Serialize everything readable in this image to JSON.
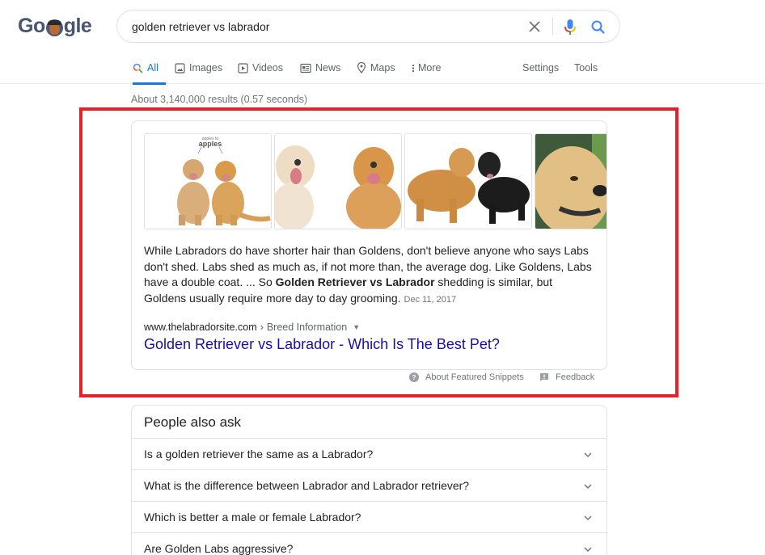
{
  "logo": {
    "text_before": "Go",
    "text_after": "gle",
    "doodle": "doodle-portrait-icon"
  },
  "search": {
    "query": "golden retriever vs labrador",
    "clear_icon": "close-icon",
    "mic_icon": "microphone-icon",
    "search_icon": "search-icon"
  },
  "tabs": [
    {
      "label": "All",
      "icon": "search-icon",
      "active": true
    },
    {
      "label": "Images",
      "icon": "image-icon",
      "active": false
    },
    {
      "label": "Videos",
      "icon": "play-icon",
      "active": false
    },
    {
      "label": "News",
      "icon": "newspaper-icon",
      "active": false
    },
    {
      "label": "Maps",
      "icon": "map-pin-icon",
      "active": false
    },
    {
      "label": "More",
      "icon": "more-vert-icon",
      "active": false
    }
  ],
  "tools": {
    "settings": "Settings",
    "tools": "Tools"
  },
  "result_stats": "About 3,140,000 results (0.57 seconds)",
  "featured_snippet": {
    "images": [
      {
        "alt": "Labrador and golden retriever sitting side by side",
        "caption_small": "apples to",
        "caption_big": "apples"
      },
      {
        "alt": "Yellow Labrador and golden retriever lying down"
      },
      {
        "alt": "Golden retriever standing beside black Labrador"
      },
      {
        "alt": "Golden retriever head close-up"
      }
    ],
    "text_part1": "While Labradors do have shorter hair than Goldens, don't believe anyone who says Labs don't shed. Labs shed as much as, if not more than, the average dog. Like Goldens, Labs have a double coat. ... So ",
    "text_bold": "Golden Retriever vs Labrador",
    "text_part2": " shedding is similar, but Goldens usually require more day to day grooming.",
    "date": "Dec 11, 2017",
    "cite_domain": "www.thelabradorsite.com",
    "cite_separator": "›",
    "cite_path": "Breed Information",
    "cite_menu_icon": "▼",
    "title_link": "Golden Retriever vs Labrador - Which Is The Best Pet?"
  },
  "snippet_footer": {
    "about": "About Featured Snippets",
    "feedback": "Feedback"
  },
  "people_also_ask": {
    "title": "People also ask",
    "questions": [
      "Is a golden retriever the same as a Labrador?",
      "What is the difference between Labrador and Labrador retriever?",
      "Which is better a male or female Labrador?",
      "Are Golden Labs aggressive?"
    ]
  },
  "colors": {
    "link": "#1a0dab",
    "active_tab": "#1a73e8",
    "highlight_frame": "#e8202a",
    "muted_text": "#70757a"
  }
}
